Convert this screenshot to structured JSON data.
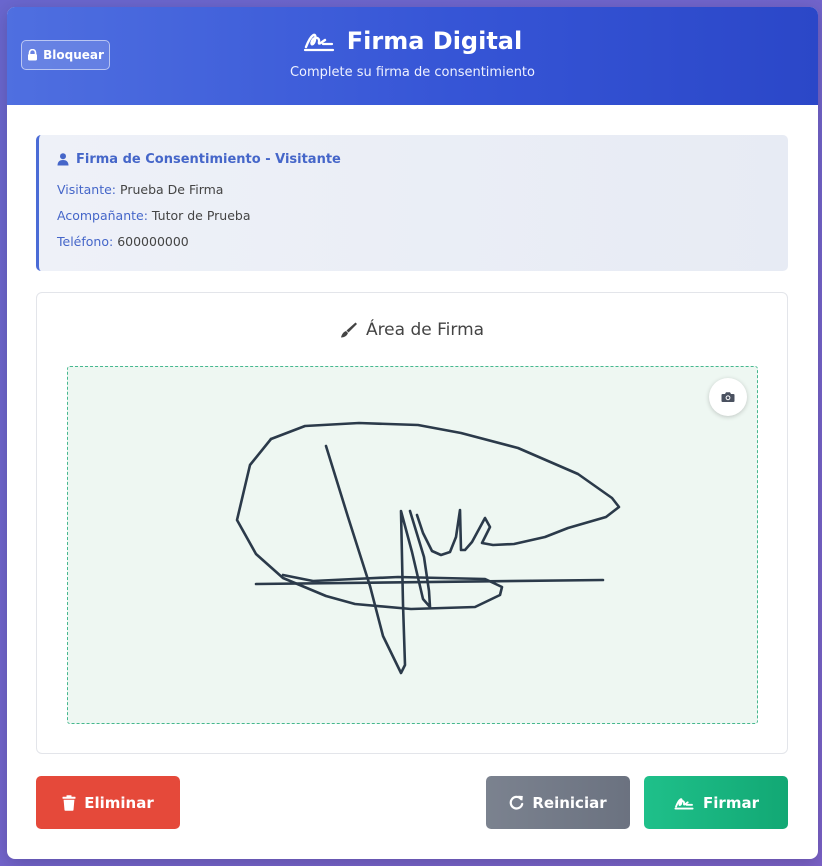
{
  "header": {
    "lock_label": "Bloquear",
    "title": "Firma Digital",
    "subtitle": "Complete su firma de consentimiento"
  },
  "info": {
    "title": "Firma de Consentimiento - Visitante",
    "rows": [
      {
        "label": "Visitante:",
        "value": "Prueba De Firma"
      },
      {
        "label": "Acompañante:",
        "value": "Tutor de Prueba"
      },
      {
        "label": "Teléfono:",
        "value": "600000000"
      }
    ]
  },
  "signature": {
    "title": "Área de Firma"
  },
  "actions": {
    "delete_label": "Eliminar",
    "reset_label": "Reiniciar",
    "sign_label": "Firmar"
  },
  "colors": {
    "primary": "#3655d6",
    "danger": "#e5493a",
    "neutral": "#6b7280",
    "success": "#12a874",
    "signature_area": "#eef7f2",
    "ink": "#2b3a4a"
  },
  "icons": {
    "lock": "lock-icon",
    "signature": "signature-icon",
    "user": "user-icon",
    "pen": "pen-icon",
    "camera": "camera-icon",
    "trash": "trash-icon",
    "redo": "redo-icon"
  }
}
